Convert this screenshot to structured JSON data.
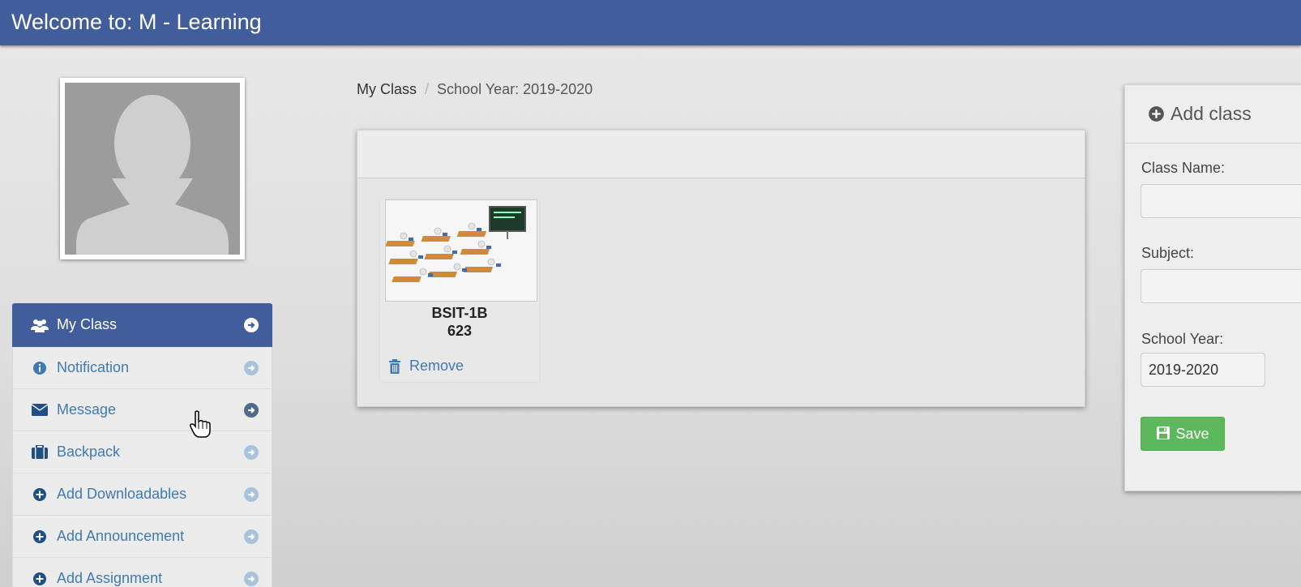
{
  "header": {
    "title": "Welcome to: M - Learning"
  },
  "colors": {
    "primary": "#425d9b",
    "link": "#3f7ab5",
    "success": "#5cb85c"
  },
  "sidebar": {
    "items": [
      {
        "label": "My Class",
        "icon": "users-icon",
        "active": true
      },
      {
        "label": "Notification",
        "icon": "info-icon"
      },
      {
        "label": "Message",
        "icon": "envelope-icon"
      },
      {
        "label": "Backpack",
        "icon": "briefcase-icon"
      },
      {
        "label": "Add Downloadables",
        "icon": "plus-circle-icon"
      },
      {
        "label": "Add Announcement",
        "icon": "plus-circle-icon"
      },
      {
        "label": "Add Assignment",
        "icon": "plus-circle-icon"
      }
    ]
  },
  "breadcrumb": {
    "first": "My Class",
    "separator": "/",
    "second": "School Year: 2019-2020"
  },
  "classes": [
    {
      "name": "BSIT-1B",
      "code": "623",
      "remove_label": "Remove",
      "image": "classroom-illustration"
    }
  ],
  "add_class": {
    "title": "Add class",
    "class_name_label": "Class Name:",
    "class_name_value": "",
    "subject_label": "Subject:",
    "subject_value": "",
    "school_year_label": "School Year:",
    "school_year_value": "2019-2020",
    "save_label": "Save"
  }
}
